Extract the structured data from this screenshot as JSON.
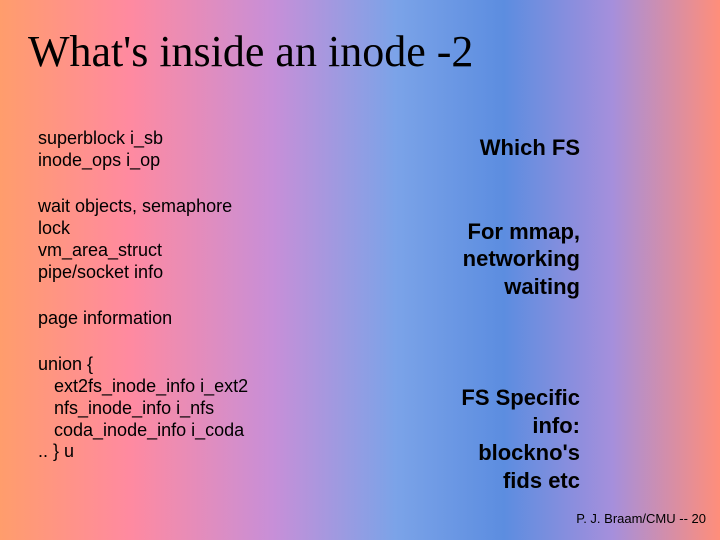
{
  "title": "What's inside an inode -2",
  "left": {
    "block1": {
      "l1": "superblock i_sb",
      "l2": "inode_ops i_op"
    },
    "block2": {
      "l1": "wait objects, semaphore",
      "l2": "lock",
      "l3": "vm_area_struct",
      "l4": "pipe/socket info"
    },
    "block3": {
      "l1": "page information"
    },
    "block4": {
      "l1": "union {",
      "l2": "ext2fs_inode_info i_ext2",
      "l3": "nfs_inode_info i_nfs",
      "l4": "coda_inode_info i_coda",
      "l5": ".. } u"
    }
  },
  "right": {
    "r1": "Which FS",
    "r2a": "For mmap,",
    "r2b": "networking",
    "r2c": "waiting",
    "r3a": "FS Specific",
    "r3b": "info:",
    "r3c": "blockno's",
    "r3d": "fids etc"
  },
  "footer": "P. J. Braam/CMU -- 20"
}
